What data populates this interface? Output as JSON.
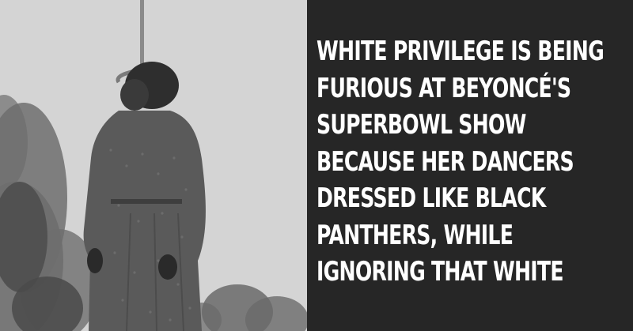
{
  "caption": {
    "lines": [
      "WHITE PRIVILEGE IS BEING",
      "FURIOUS AT BEYONCÉ'S",
      "SUPERBOWL SHOW",
      "BECAUSE HER DANCERS",
      "DRESSED LIKE BLACK",
      "PANTHERS, WHILE",
      "IGNORING THAT WHITE"
    ]
  },
  "colors": {
    "text_panel_background": "#262626",
    "caption_text": "#ffffff"
  }
}
